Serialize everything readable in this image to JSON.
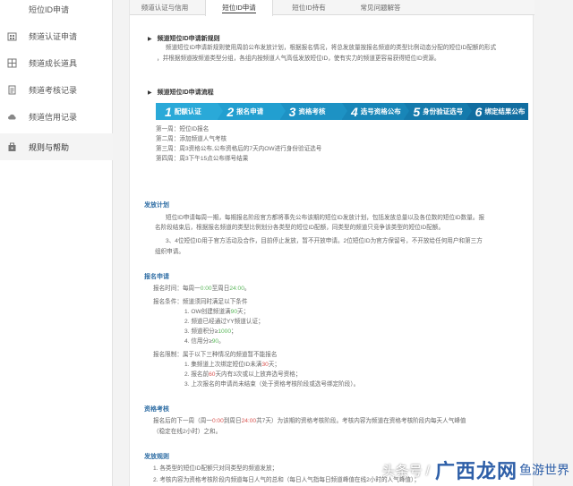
{
  "sidebar": {
    "items": [
      {
        "label": "短位ID申请",
        "icon": "none"
      },
      {
        "label": "频道认证申请",
        "icon": "building-icon"
      },
      {
        "label": "频道成长道具",
        "icon": "grid-icon"
      },
      {
        "label": "频道考核记录",
        "icon": "document-icon"
      },
      {
        "label": "频道信用记录",
        "icon": "cloud-icon"
      },
      {
        "label": "规则与帮助",
        "icon": "bag-icon"
      }
    ]
  },
  "tabs": [
    {
      "label": "频道认证与信用"
    },
    {
      "label": "短位ID申请"
    },
    {
      "label": "短位ID持有"
    },
    {
      "label": "常见问题解答"
    }
  ],
  "section1": {
    "title": "频道短位ID申请新规则",
    "body1": "频道短位ID申请新规则使用周前公布发放计划，根据报名情况，将总发放量按报名频道的类型比例动态分配的短位ID配额的形式",
    "body2": "，并根据频道按频道类型分组，各组内按频道人气高低发放短位ID，使有实力的频道更容易获得短位ID资源。"
  },
  "section2": {
    "title": "频道短位ID申请流程",
    "steps": [
      {
        "num": "1",
        "label": "配额认证",
        "color": "#2aa9d8"
      },
      {
        "num": "2",
        "label": "报名申请",
        "color": "#229fd0"
      },
      {
        "num": "3",
        "label": "资格考核",
        "color": "#1d92c4"
      },
      {
        "num": "4",
        "label": "选号资格公布",
        "color": "#1886b8"
      },
      {
        "num": "5",
        "label": "身份验证选号",
        "color": "#147aac"
      },
      {
        "num": "6",
        "label": "绑定结果公布",
        "color": "#116da0"
      }
    ],
    "lines": [
      "第一周：短位ID报名",
      "第二周：添加频道人气考核",
      "第三周：周3资格公布,公布资格后的7天内OW进行身份验证选号",
      "第四周：周3下午15点公布绑号结果"
    ]
  },
  "plan": {
    "head": "发放计划",
    "p1a": "短位ID申请每周一期，每期报名阶段官方都将事先公布该期的短位ID发放计划，包括发放总量以及各位数的短位ID数量。报",
    "p1b": "名阶段结束后，根据报名频道的类型比例划分各类型的短位ID配额，同类型的频道只竞争该类型的短位ID配额。",
    "p2a": "3、4位短位ID用于官方活动及合作，目前停止发放，暂不开放申请。2位短位ID为官方保留号，不开放给任何用户和第三方",
    "p2b": "组织申请。"
  },
  "apply": {
    "head": "报名申请",
    "time_label": "报名时间：每周一",
    "time_start": "0:00",
    "time_mid": "至周日",
    "time_end": "24:00",
    "time_tail": "。",
    "cond_label": "报名条件：频道须同时满足以下条件",
    "conds": [
      {
        "text": "1. OW创建频道满",
        "hl": "90",
        "tail": "天；"
      },
      {
        "text": "2. 频道已经通过YY频道认证；",
        "hl": "",
        "tail": ""
      },
      {
        "text": "3. 频道积分≥",
        "hl": "1000",
        "tail": "；"
      },
      {
        "text": "4. 信用分≥",
        "hl": "90",
        "tail": "。"
      }
    ],
    "limit_label": "报名限制：属于以下三种情况的频道暂不能报名",
    "limits": [
      {
        "text": "1. 集频道上次绑定短位ID未满",
        "hl": "30",
        "tail": "天；"
      },
      {
        "text": "2. 报名前",
        "hl": "60",
        "tail": "天内有3次或以上放弃选号资格；"
      },
      {
        "text": "3. 上次报名的申请尚未结束（处于资格考核阶段或选号绑定阶段）。",
        "hl": "",
        "tail": ""
      }
    ]
  },
  "review": {
    "head": "资格考核",
    "line1a": "报名后的下一周（周一",
    "line1b": "0:00",
    "line1c": "到周日",
    "line1d": "24:00",
    "line1e": "共7天）为该期的资格考核阶段。考核内容为频道在资格考核阶段内每天人气峰值",
    "line2": "（稳定在线2小时）之和。"
  },
  "rules": {
    "head": "发放规则",
    "line1": "1. 各类型的短位ID配额只对同类型的频道发放；",
    "line2": "2. 考核内容为资格考核阶段内频道每日人气的总和（每日人气指每日频道峰值在线2小时的人气峰值）；"
  },
  "watermark": {
    "text1": "头条号 /",
    "text2": "广西龙网",
    "text3": "鱼游世界"
  }
}
